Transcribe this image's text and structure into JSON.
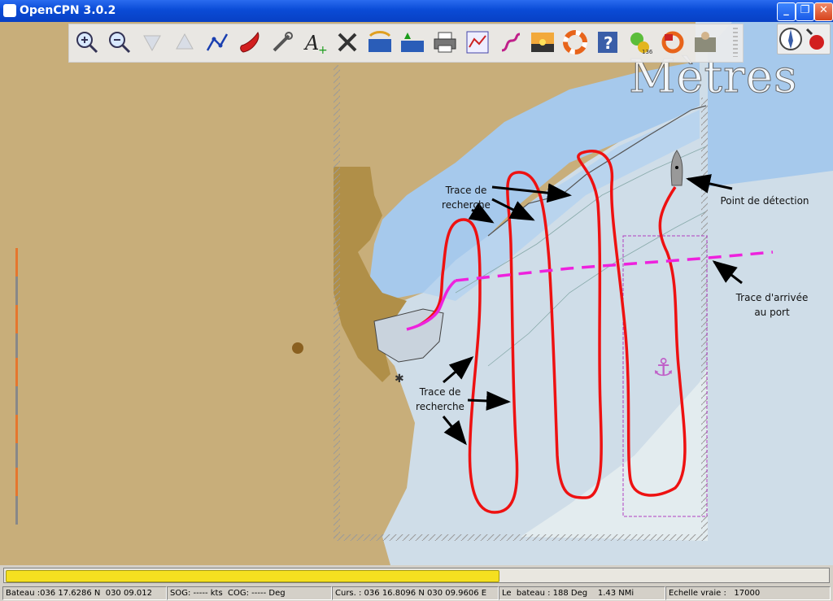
{
  "window": {
    "title": "OpenCPN 3.0.2"
  },
  "chart": {
    "watermark": "Mètres",
    "annotations": {
      "search_track_top": "Trace de recherche",
      "search_track_bottom": "Trace de recherche",
      "detection_point": "Point de détection",
      "arrival_track": "Trace d'arrivée au port"
    }
  },
  "toolbar": {
    "buttons": [
      "zoom-in-icon",
      "zoom-out-icon",
      "scale-down-icon",
      "scale-up-icon",
      "route-icon",
      "ship-icon",
      "settings-icon",
      "text-icon",
      "tide-icon",
      "current-icon",
      "print-icon",
      "route-manager-icon",
      "track-icon",
      "color-scheme-icon",
      "mob-icon",
      "help-icon",
      "ais-icon",
      "lifebuoy-icon",
      "plugin-icon"
    ]
  },
  "progress": {
    "fraction": 0.6
  },
  "status": {
    "boat": "Bateau :036 17.6286 N  030 09.012",
    "sog_cog": "SOG: ----- kts  COG: ----- Deg",
    "cursor": "Curs. : 036 16.8096 N 030 09.9606 E",
    "bearing": "Le  bateau : 188 Deg    1.43 NMi",
    "scale": "Echelle vraie :   17000"
  },
  "colors": {
    "land": "#c8ae7a",
    "shallow": "#a6c9ec",
    "deep": "#cfdde8",
    "track": "#ee1111",
    "arrival_track": "#ee22dd"
  }
}
